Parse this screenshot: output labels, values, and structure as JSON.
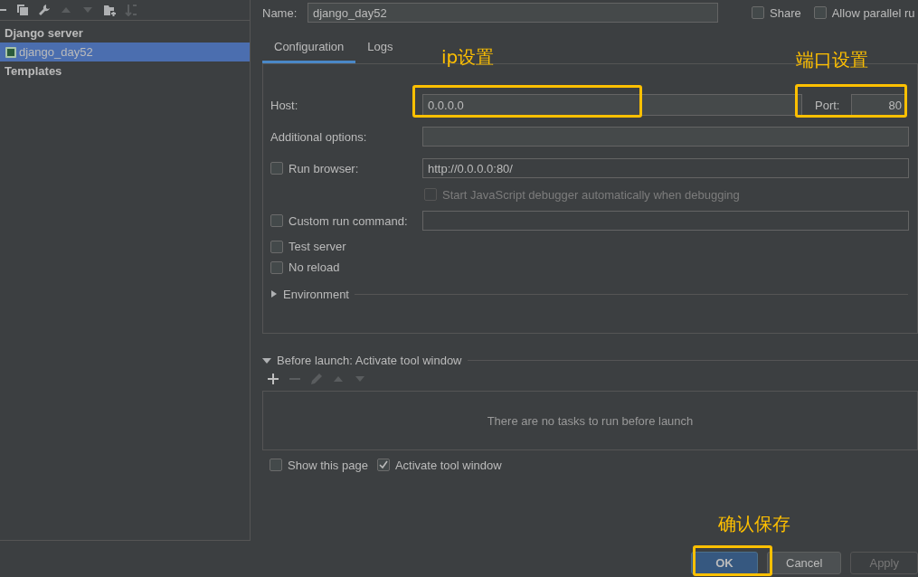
{
  "sidebar": {
    "items": [
      {
        "label": "Django server",
        "selected": false,
        "children": [
          {
            "label": "django_day52",
            "selected": true
          }
        ]
      },
      {
        "label": "Templates",
        "selected": false
      }
    ]
  },
  "name_field": {
    "label": "Name:",
    "value": "django_day52"
  },
  "share": {
    "label": "Share",
    "checked": false
  },
  "allow_parallel": {
    "label": "Allow parallel ru",
    "checked": false
  },
  "tabs": [
    {
      "label": "Configuration",
      "selected": true
    },
    {
      "label": "Logs",
      "selected": false
    }
  ],
  "host": {
    "label": "Host:",
    "value": "0.0.0.0"
  },
  "port": {
    "label": "Port:",
    "value": "80"
  },
  "additional_options": {
    "label": "Additional options:"
  },
  "run_browser": {
    "label": "Run browser:",
    "checked": false,
    "value": "http://0.0.0.0:80/"
  },
  "js_debugger": {
    "label": "Start JavaScript debugger automatically when debugging",
    "checked": false,
    "disabled": true
  },
  "custom_run_command": {
    "label": "Custom run command:",
    "checked": false
  },
  "test_server": {
    "label": "Test server",
    "checked": false
  },
  "no_reload": {
    "label": "No reload",
    "checked": false
  },
  "environment": {
    "label": "Environment",
    "expanded": false
  },
  "before_launch": {
    "label": "Before launch: Activate tool window",
    "expanded": true,
    "empty_message": "There are no tasks to run before launch"
  },
  "show_this_page": {
    "label": "Show this page",
    "checked": false
  },
  "activate_tool_window": {
    "label": "Activate tool window",
    "checked": true
  },
  "buttons": [
    {
      "label": "OK",
      "kind": "default"
    },
    {
      "label": "Cancel",
      "kind": "normal"
    },
    {
      "label": "Apply",
      "kind": "disabled"
    }
  ],
  "annotations": [
    {
      "text": "ip设置"
    },
    {
      "text": "端口设置"
    },
    {
      "text": "确认保存"
    }
  ]
}
